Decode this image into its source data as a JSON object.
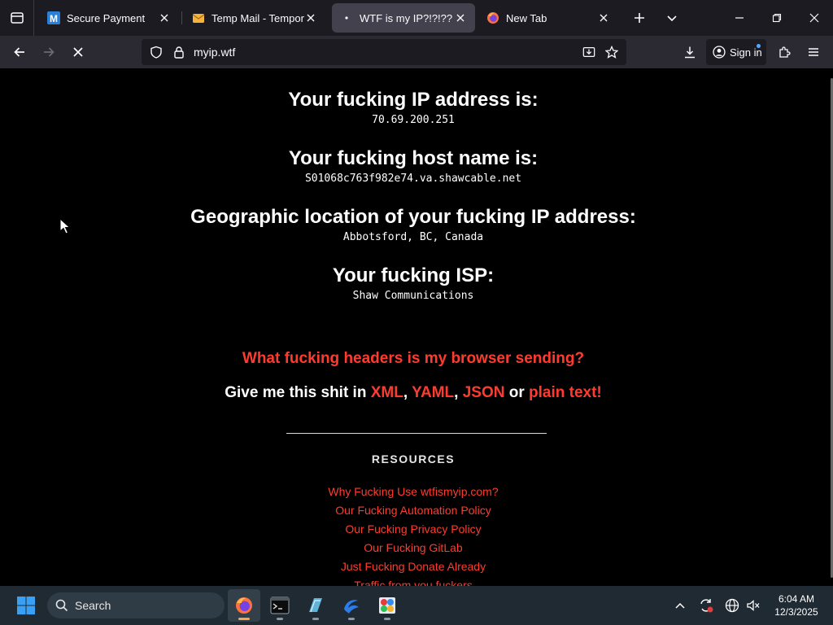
{
  "browser": {
    "tabs": [
      {
        "title": "Secure Payment",
        "favicon": "m-logo-icon"
      },
      {
        "title": "Temp Mail - Temporary",
        "favicon": "mail-icon"
      },
      {
        "title": "WTF is my IP?!?!??",
        "favicon": "loading-icon"
      },
      {
        "title": "New Tab",
        "favicon": "firefox-icon"
      }
    ],
    "url": "myip.wtf",
    "sign_in_label": "Sign in"
  },
  "page": {
    "ip_heading": "Your fucking IP address is:",
    "ip_value": "70.69.200.251",
    "host_heading": "Your fucking host name is:",
    "host_value": "S01068c763f982e74.va.shawcable.net",
    "geo_heading": "Geographic location of your fucking IP address:",
    "geo_value": "Abbotsford, BC, Canada",
    "isp_heading": "Your fucking ISP:",
    "isp_value": "Shaw Communications",
    "headers_link": "What fucking headers is my browser sending?",
    "give_prefix": "Give me this shit in ",
    "formats": [
      "XML",
      "YAML",
      "JSON",
      "plain text!"
    ],
    "sep1": ", ",
    "sep2": ", ",
    "sep3": " or ",
    "resources_title": "RESOURCES",
    "resources": [
      "Why Fucking Use wtfismyip.com?",
      "Our Fucking Automation Policy",
      "Our Fucking Privacy Policy",
      "Our Fucking GitLab",
      "Just Fucking Donate Already",
      "Traffic from you fuckers"
    ]
  },
  "taskbar": {
    "search_placeholder": "Search",
    "time": "6:04 AM",
    "date": "12/3/2025"
  },
  "colors": {
    "link_red": "#ff3b2f",
    "background": "#000000"
  }
}
